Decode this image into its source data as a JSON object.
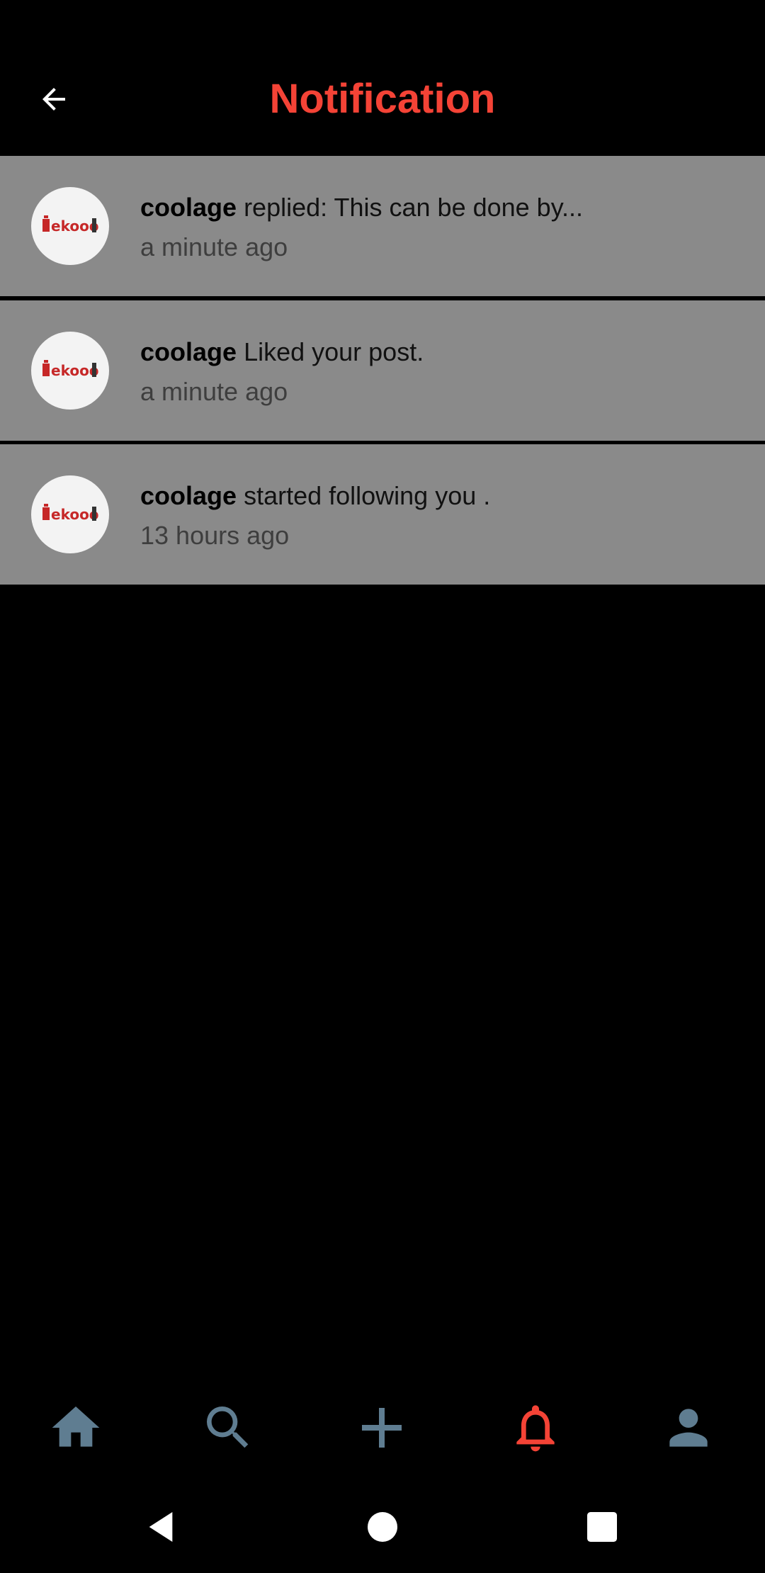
{
  "app_bar": {
    "title": "Notification",
    "title_color": "#f44336",
    "back_icon": "arrow-back-icon"
  },
  "notifications": [
    {
      "user": "coolage",
      "message": "replied: This can be done by...",
      "time": "a minute ago",
      "avatar_text": "ekooo"
    },
    {
      "user": "coolage",
      "message": "Liked your post.",
      "time": "a minute ago",
      "avatar_text": "ekooo"
    },
    {
      "user": "coolage",
      "message": "started following you .",
      "time": "13 hours ago",
      "avatar_text": "ekooo"
    }
  ],
  "bottom_nav": {
    "items": [
      {
        "icon": "home-icon",
        "active": false
      },
      {
        "icon": "search-icon",
        "active": false
      },
      {
        "icon": "add-icon",
        "active": false
      },
      {
        "icon": "bell-icon",
        "active": true
      },
      {
        "icon": "person-icon",
        "active": false
      }
    ],
    "active_color": "#f44336",
    "inactive_color": "#5f7d91"
  },
  "system_nav": {
    "buttons": [
      "back-triangle-icon",
      "home-circle-icon",
      "recents-square-icon"
    ]
  }
}
